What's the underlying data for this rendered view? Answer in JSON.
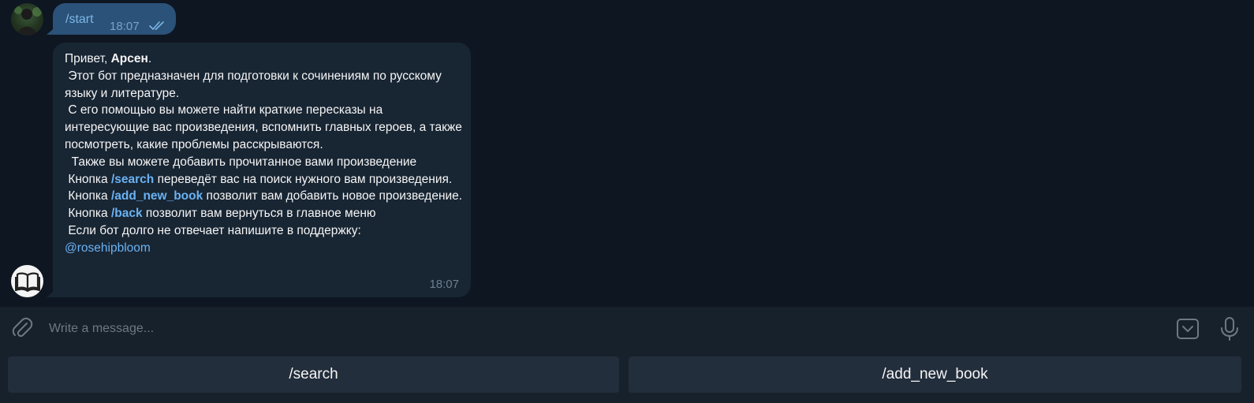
{
  "chat": {
    "outgoing": {
      "text": "/start",
      "time": "18:07"
    },
    "incoming": {
      "greeting": "Привет, ",
      "name": "Арсен",
      "greeting_end": ".",
      "line1": " Этот бот предназначен для подготовки к сочинениям по русскому языку и литературе.",
      "line2": " С его помощью вы можете найти краткие пересказы на интересующие вас произведения, вспомнить главных героев, а также посмотреть, какие проблемы расскрываются.",
      "line3": "  Также вы можете добавить прочитанное вами произведение",
      "btn_prefix": " Кнопка ",
      "search_cmd": "/search",
      "search_desc": " переведёт вас на поиск нужного вам произведения.",
      "add_cmd": "/add_new_book",
      "add_desc": " позволит вам добавить новое произведение.",
      "back_cmd": "/back",
      "back_desc": " позволит вам вернуться в главное меню",
      "support": " Если бот долго не отвечает напишите в поддержку:",
      "mention": "@rosehipbloom",
      "time": "18:07"
    }
  },
  "composer": {
    "placeholder": "Write a message..."
  },
  "keyboard": {
    "buttons": [
      "/search",
      "/add_new_book"
    ]
  },
  "colors": {
    "background": "#0e1621",
    "outgoing_bubble": "#2b5278",
    "incoming_bubble": "#182533",
    "link": "#6ab2f2",
    "keyboard_button": "#232e3c"
  },
  "icons": {
    "attach": "paperclip-icon",
    "keyboard_toggle": "keyboard-toggle-icon",
    "mic": "microphone-icon",
    "bot_avatar": "book-icon",
    "read_status": "double-check-icon"
  }
}
